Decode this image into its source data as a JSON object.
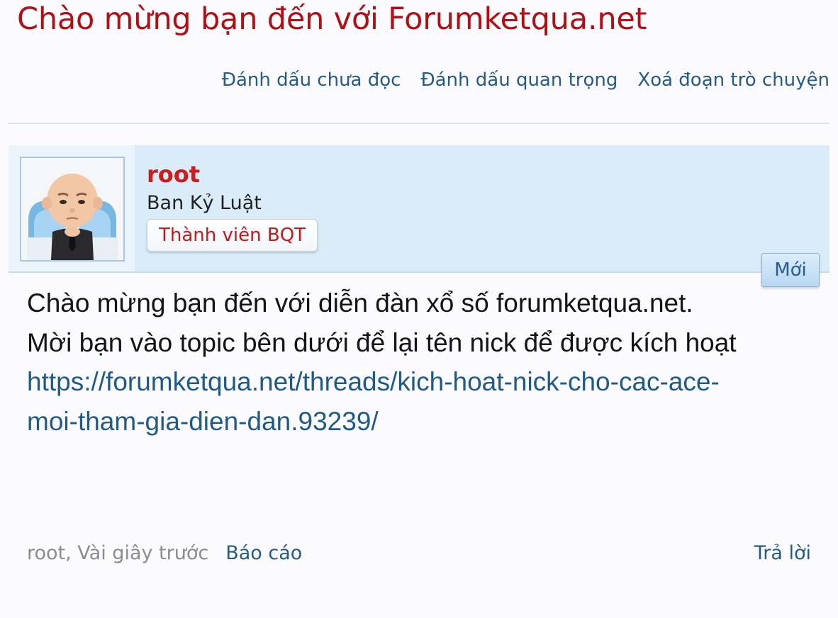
{
  "page_title": "Chào mừng bạn đến với Forumketqua.net",
  "actions": {
    "mark_unread": "Đánh dấu chưa đọc",
    "mark_important": "Đánh dấu quan trọng",
    "delete_conversation": "Xoá đoạn trò chuyện"
  },
  "post": {
    "username": "root",
    "user_title": "Ban Kỷ Luật",
    "role_badge": "Thành viên BQT",
    "new_badge": "Mới",
    "message_lines": [
      "Chào mừng bạn đến với diễn đàn xổ số forumketqua.net.",
      "Mời bạn vào topic bên dưới để lại tên nick để được kích hoạt"
    ],
    "link": "https://forumketqua.net/threads/kich-hoat-nick-cho-cac-ace-moi-tham-gia-dien-dan.93239/",
    "meta": "root, Vài giây trước",
    "report": "Báo cáo",
    "reply": "Trả lời"
  },
  "colors": {
    "title": "#b30f12",
    "link": "#245c86",
    "user_block_bg": "#dbecf9",
    "username": "#cc1d1d"
  }
}
